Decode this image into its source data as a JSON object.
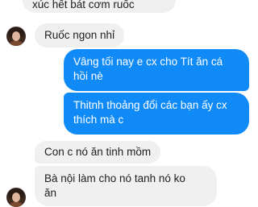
{
  "messages": [
    {
      "id": "b0",
      "side": "in",
      "lines": [
        "xúc hết bát cơm ruốc"
      ]
    },
    {
      "id": "b1",
      "side": "in",
      "lines": [
        "Ruốc ngon nhỉ"
      ]
    },
    {
      "id": "b2",
      "side": "out",
      "lines": [
        "Vâng tối nay e cx cho Tít ăn cá",
        "hồi nè"
      ]
    },
    {
      "id": "b3",
      "side": "out",
      "lines": [
        "Thitnh thoảng đổi các bạn ấy cx",
        "thích mà c"
      ]
    },
    {
      "id": "b4",
      "side": "in",
      "lines": [
        "Con c nó ăn tinh mồm"
      ]
    },
    {
      "id": "b5",
      "side": "in",
      "lines": [
        "Bà nội làm cho nó tanh nó ko",
        "ăn"
      ]
    }
  ],
  "colors": {
    "incoming_bubble": "#f1f0f0",
    "outgoing_bubble": "#0f8af7",
    "incoming_text": "#1c1e21",
    "outgoing_text": "#ffffff"
  },
  "icons": {
    "contact_avatar": "avatar"
  }
}
